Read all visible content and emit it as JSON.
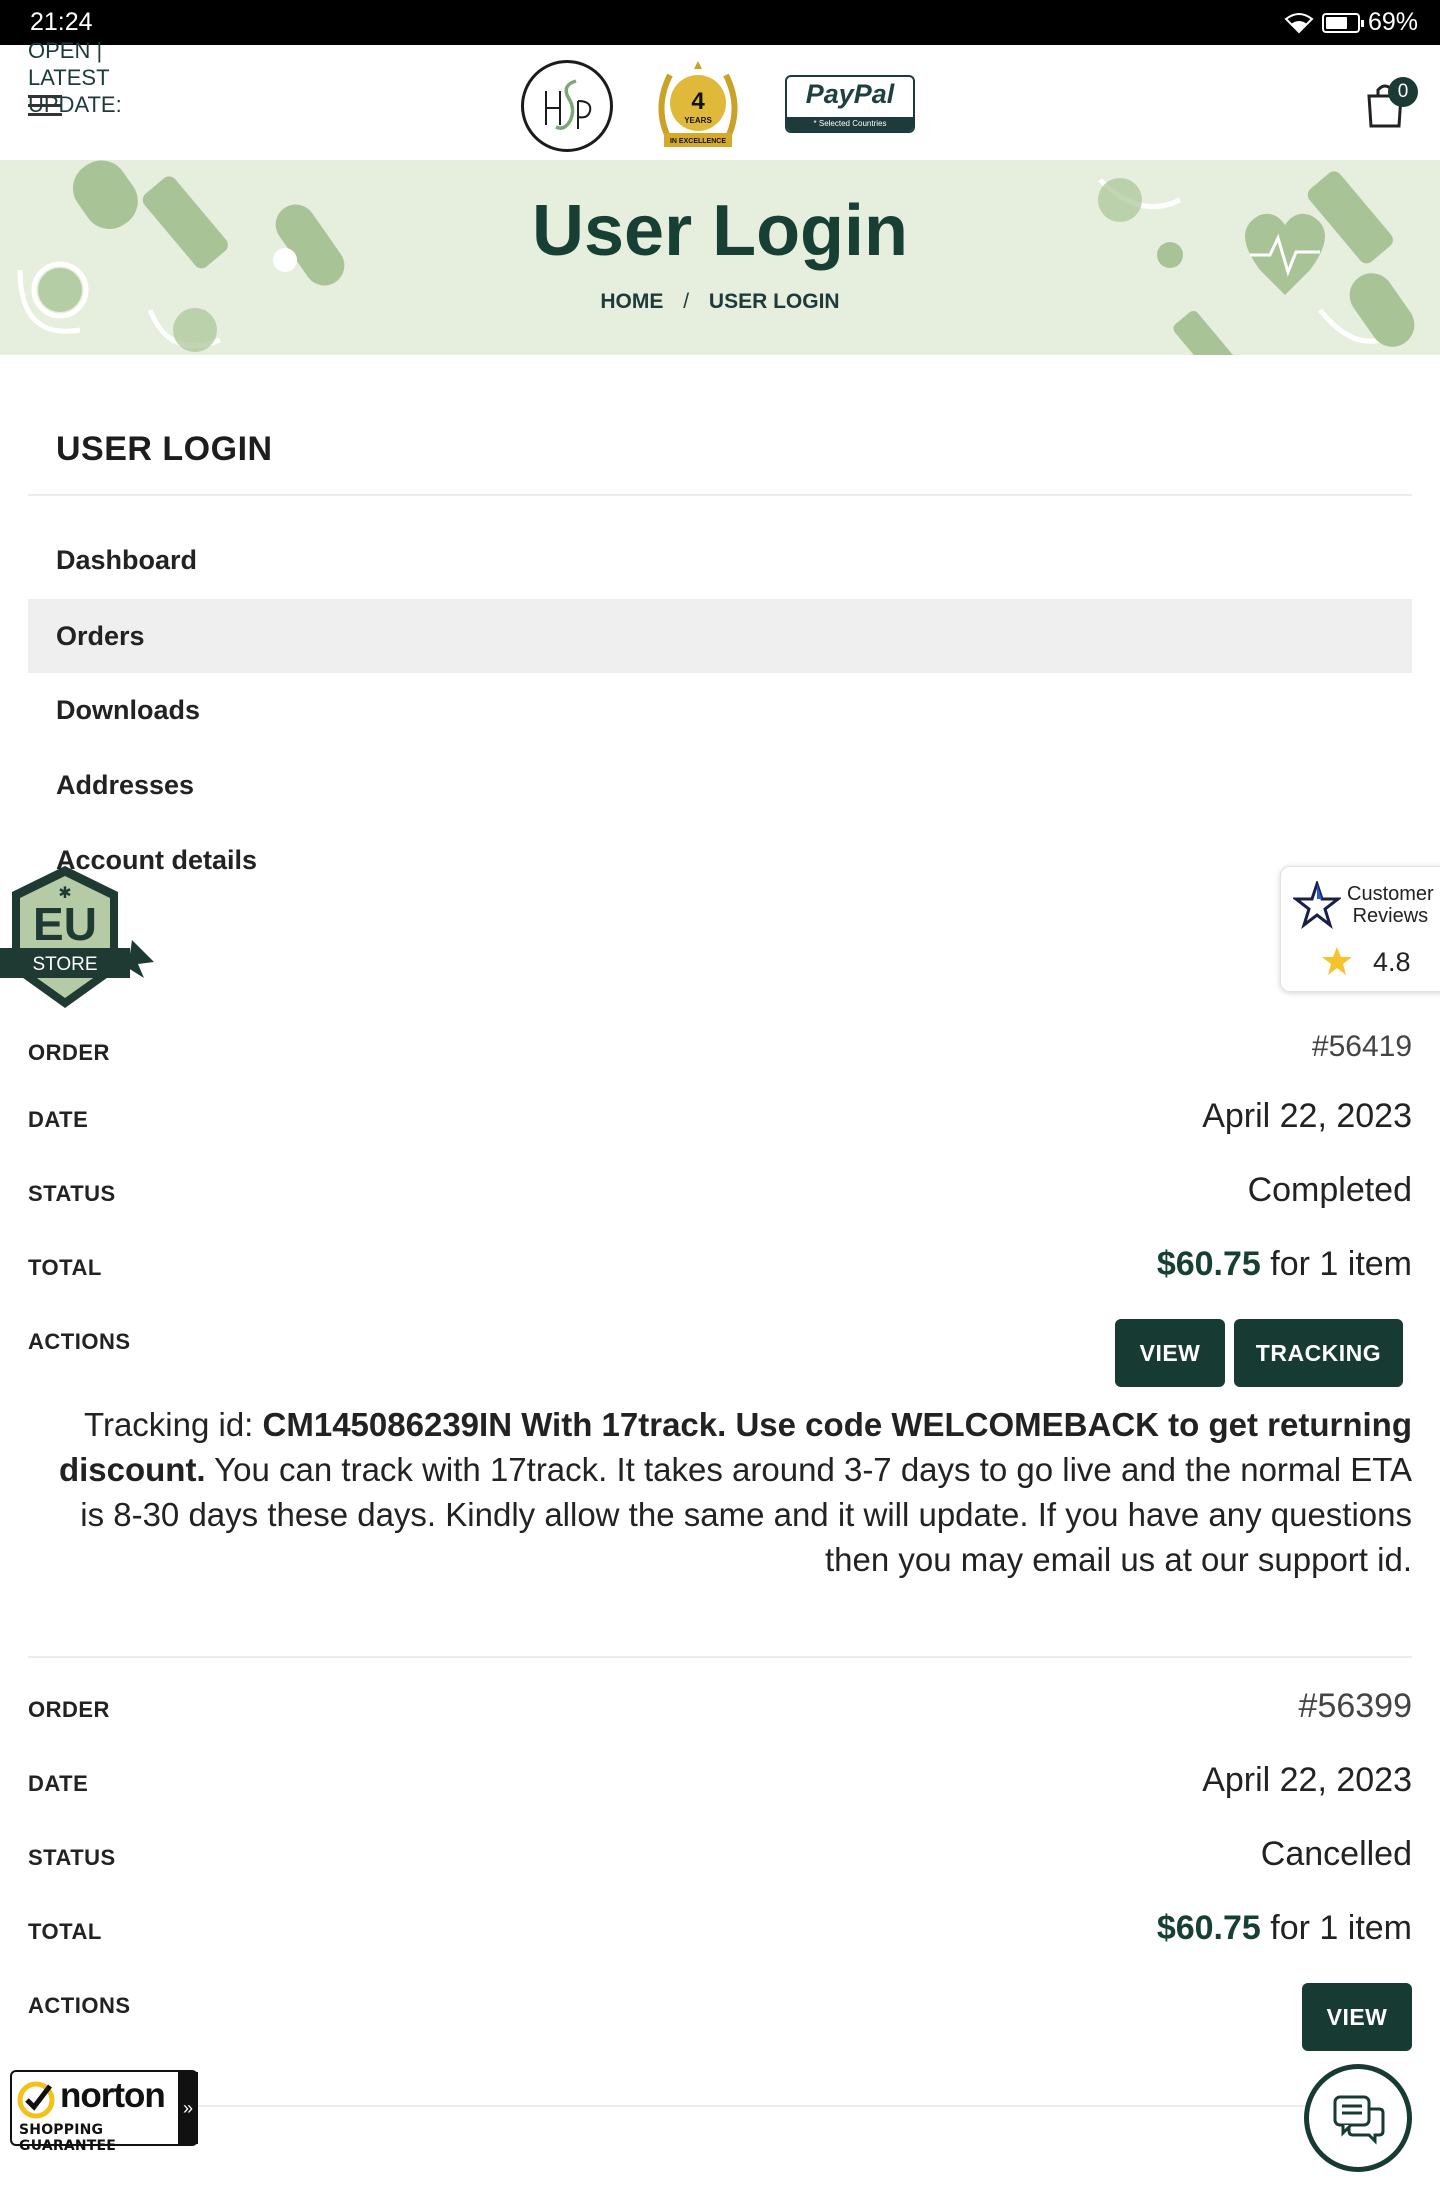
{
  "status_bar": {
    "time": "21:24",
    "battery": "69%",
    "battery_level": 0.69
  },
  "header": {
    "notice_lines": [
      "OPEN |",
      "LATEST",
      "UPDATE:"
    ],
    "laurel": {
      "number": "4",
      "word": "YEARS",
      "ribbon": "IN EXCELLENCE"
    },
    "paypal": {
      "brand": "PayPal",
      "sub": "* Selected Countries"
    },
    "cart_count": "0"
  },
  "hero": {
    "title": "User Login",
    "breadcrumb": {
      "home": "HOME",
      "separator": "/",
      "current": "USER LOGIN"
    }
  },
  "account": {
    "title": "USER LOGIN",
    "nav": [
      "Dashboard",
      "Orders",
      "Downloads",
      "Addresses",
      "Account details"
    ],
    "active_nav": "Orders"
  },
  "orders": [
    {
      "labels": {
        "order": "ORDER",
        "date": "DATE",
        "status": "STATUS",
        "total": "TOTAL",
        "actions": "ACTIONS"
      },
      "number": "#56419",
      "date": "April 22, 2023",
      "status": "Completed",
      "amount": "$60.75",
      "items": "for 1 item",
      "buttons": [
        "VIEW",
        "TRACKING"
      ],
      "note": {
        "prefix": "Tracking id: ",
        "bold": "CM145086239IN With 17track. Use code WELCOMEBACK to get returning discount.",
        "rest": " You can track with 17track. It takes around 3-7 days to go live and the normal ETA is 8-30 days these days. Kindly allow the same and it will update. If you have any questions then you may email us at our support id."
      }
    },
    {
      "labels": {
        "order": "ORDER",
        "date": "DATE",
        "status": "STATUS",
        "total": "TOTAL",
        "actions": "ACTIONS"
      },
      "number": "#56399",
      "date": "April 22, 2023",
      "status": "Cancelled",
      "amount": "$60.75",
      "items": "for 1 item",
      "buttons": [
        "VIEW"
      ]
    }
  ],
  "eu_badge": {
    "top": "EU",
    "bottom": "STORE"
  },
  "reviews_widget": {
    "title_line1": "Customer",
    "title_line2": "Reviews",
    "rating": "4.8"
  },
  "norton": {
    "brand": "norton",
    "tagline": "SHOPPING GUARANTEE"
  },
  "colors": {
    "brand_dark": "#173a33",
    "hero_bg": "#e6eedd",
    "active_nav_bg": "#efefef"
  }
}
